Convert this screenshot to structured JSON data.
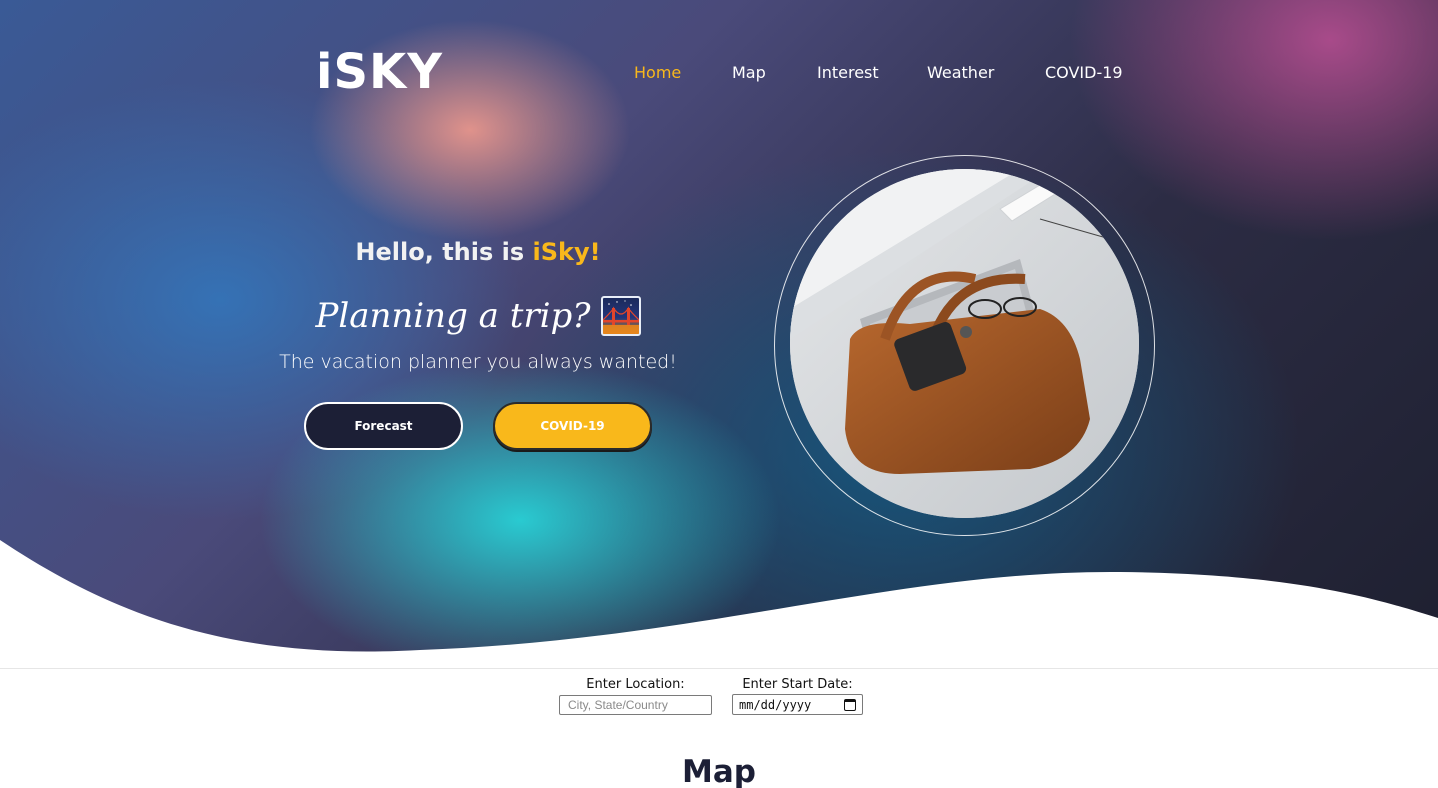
{
  "brand": {
    "logo_text": "iSKY"
  },
  "nav": {
    "items": [
      {
        "label": "Home",
        "active": true
      },
      {
        "label": "Map",
        "active": false
      },
      {
        "label": "Interest",
        "active": false
      },
      {
        "label": "Weather",
        "active": false
      },
      {
        "label": "COVID-19",
        "active": false
      }
    ]
  },
  "hero": {
    "greeting_prefix": "Hello, this is ",
    "greeting_name": "iSky!",
    "tagline": "Planning a trip?",
    "tagline_icon": "bridge-at-night-icon",
    "subtitle": "The vacation planner you always wanted!",
    "buttons": {
      "forecast": "Forecast",
      "covid": "COVID-19"
    },
    "image": "travel-bag-photo"
  },
  "search": {
    "location_label": "Enter Location:",
    "location_placeholder": "City, State/Country",
    "date_label": "Enter Start Date:",
    "date_placeholder": "mm/dd/yyyy"
  },
  "sections": {
    "map_title": "Map"
  },
  "colors": {
    "accent": "#f9b81b",
    "dark": "#1c1f36",
    "text_light": "#ffffff"
  }
}
